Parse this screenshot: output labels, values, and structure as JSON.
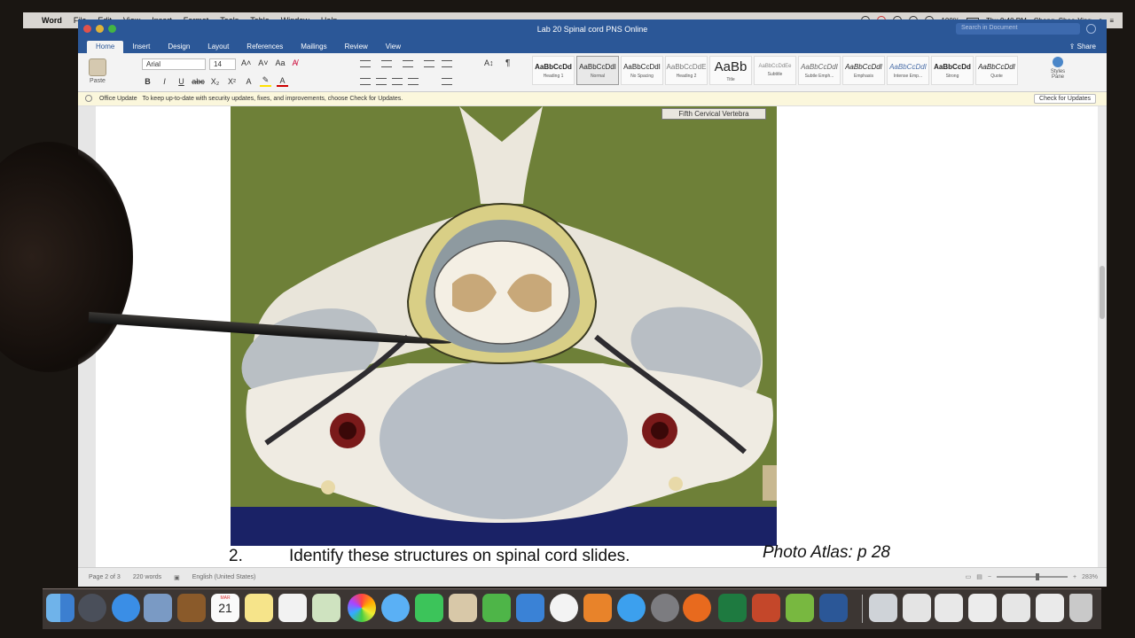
{
  "menubar": {
    "apple": "",
    "app": "Word",
    "items": [
      "File",
      "Edit",
      "View",
      "Insert",
      "Format",
      "Tools",
      "Table",
      "Window",
      "Help"
    ],
    "battery": "100%",
    "clock": "Thu 9:40 PM",
    "user": "Cheng, Shao-Ying"
  },
  "window": {
    "title": "Lab 20 Spinal cord PNS Online",
    "search_placeholder": "Search in Document",
    "share": "Share"
  },
  "ribbon": {
    "tabs": [
      "Home",
      "Insert",
      "Design",
      "Layout",
      "References",
      "Mailings",
      "Review",
      "View"
    ],
    "active_tab": "Home",
    "paste": "Paste",
    "font_name": "Arial",
    "font_size": "14",
    "styles": [
      {
        "sample": "AaBbCcDd",
        "name": "Heading 1"
      },
      {
        "sample": "AaBbCcDdI",
        "name": "Normal"
      },
      {
        "sample": "AaBbCcDdI",
        "name": "No Spacing"
      },
      {
        "sample": "AaBbCcDdE",
        "name": "Heading 2"
      },
      {
        "sample": "AaBb",
        "name": "Title"
      },
      {
        "sample": "AaBbCcDdEe",
        "name": "Subtitle"
      },
      {
        "sample": "AaBbCcDdI",
        "name": "Subtle Emph..."
      },
      {
        "sample": "AaBbCcDdI",
        "name": "Emphasis"
      },
      {
        "sample": "AaBbCcDdI",
        "name": "Intense Emp..."
      },
      {
        "sample": "AaBbCcDd",
        "name": "Strong"
      },
      {
        "sample": "AaBbCcDdI",
        "name": "Quote"
      }
    ],
    "styles_pane": "Styles Pane"
  },
  "infobar": {
    "label": "Office Update",
    "message": "To keep up-to-date with security updates, fixes, and improvements, choose Check for Updates.",
    "button": "Check for Updates"
  },
  "document": {
    "photo_label": "Fifth Cervical Vertebra",
    "item_number": "2.",
    "item_text": "Identify these structures on spinal cord slides.",
    "reference": "Photo Atlas: p 28"
  },
  "statusbar": {
    "page": "Page 2 of 3",
    "words": "220 words",
    "language": "English (United States)",
    "zoom": "283%"
  },
  "dock": {
    "calendar_month": "MAR",
    "calendar_day": "21"
  }
}
